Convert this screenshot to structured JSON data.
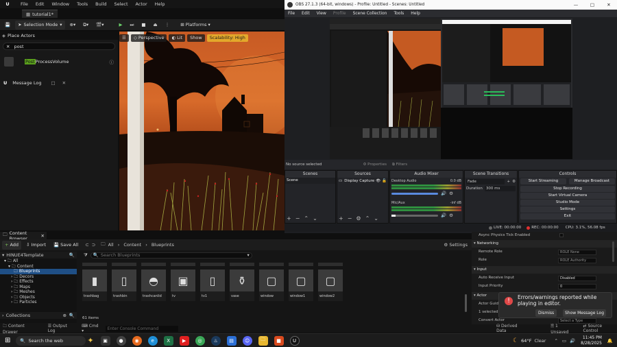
{
  "ue": {
    "menu": [
      "File",
      "Edit",
      "Window",
      "Tools",
      "Build",
      "Select",
      "Actor",
      "Help"
    ],
    "tab_title": "tutorial1*",
    "toolbar": {
      "selection_mode": "Selection Mode",
      "platforms": "Platforms"
    },
    "place_actors": {
      "tab": "Place Actors",
      "search_value": "post",
      "result_highlight": "Post",
      "result_rest": "ProcessVolume"
    },
    "message_log": "Message Log",
    "viewport": {
      "perspective": "Perspective",
      "lit": "Lit",
      "show": "Show",
      "scalability": "Scalability: High"
    },
    "content_browser": {
      "tab": "Content Browser",
      "add": "Add",
      "import": "Import",
      "save_all": "Save All",
      "breadcrumb": [
        "All",
        "Content",
        "Blueprints"
      ],
      "settings": "Settings",
      "project": "HINUE4Template",
      "search_placeholder": "Search Blueprints",
      "tree": [
        "All",
        "Content",
        "Blueprints",
        "Decors",
        "Effects",
        "Maps",
        "Meshes",
        "Objects",
        "Particles"
      ],
      "collections": "Collections",
      "items_count": "61 items",
      "assets": [
        {
          "name": "trashbag",
          "icon": "bag"
        },
        {
          "name": "trashbin",
          "icon": "bin"
        },
        {
          "name": "trashcanlid",
          "icon": "lid"
        },
        {
          "name": "tv",
          "icon": "tv"
        },
        {
          "name": "tv1",
          "icon": "bin"
        },
        {
          "name": "vase",
          "icon": "vase"
        },
        {
          "name": "window",
          "icon": "frame"
        },
        {
          "name": "window1",
          "icon": "frame"
        },
        {
          "name": "window2",
          "icon": "frame"
        }
      ]
    },
    "details": {
      "rows_top": [
        "Async Physics Tick Enabled"
      ],
      "section_networking": "Networking",
      "remote_role": {
        "label": "Remote Role",
        "value": "ROLE None"
      },
      "role": {
        "label": "Role",
        "value": "ROLE Authority"
      },
      "section_input": "Input",
      "auto_receive_input": {
        "label": "Auto Receive Input",
        "value": "Disabled"
      },
      "input_priority": {
        "label": "Input Priority",
        "value": "0"
      },
      "section_actor": "Actor",
      "actor_guid": "Actor Guid",
      "selected": "1 selected in",
      "convert_actor": "Convert Actor",
      "select_a_type": "Select a Type"
    },
    "toast": {
      "message": "Errors/warnings reported while playing in editor.",
      "dismiss": "Dismiss",
      "show_log": "Show Message Log"
    },
    "bottombar": {
      "content_drawer": "Content Drawer",
      "output_log": "Output Log",
      "cmd": "Cmd",
      "cmd_placeholder": "Enter Console Command",
      "derived_data": "Derived Data",
      "unsaved": "1 Unsaved",
      "source_control": "Source Control"
    }
  },
  "obs": {
    "title": "OBS 27.1.3 (64-bit, windows) - Profile: Untitled - Scenes: Untitled",
    "menu": [
      "File",
      "Edit",
      "View",
      "Profile",
      "Scene Collection",
      "Tools",
      "Help"
    ],
    "no_source": "No source selected",
    "properties": "Properties",
    "filters": "Filters",
    "scenes": {
      "header": "Scenes",
      "items": [
        "Scene"
      ]
    },
    "sources": {
      "header": "Sources",
      "items": [
        "Display Capture"
      ]
    },
    "audio": {
      "header": "Audio Mixer",
      "channels": [
        {
          "name": "Desktop Audio",
          "db": "0.0 dB"
        },
        {
          "name": "Mic/Aux",
          "db": "-inf dB"
        }
      ]
    },
    "transitions": {
      "header": "Scene Transitions",
      "type": "Fade",
      "duration_label": "Duration",
      "duration": "300 ms"
    },
    "controls": {
      "header": "Controls",
      "buttons": [
        "Start Streaming",
        "Manage Broadcast",
        "Stop Recording",
        "Start Virtual Camera",
        "Studio Mode",
        "Settings",
        "Exit"
      ]
    },
    "status": {
      "live": "LIVE: 00:00:00",
      "rec": "REC: 00:00:00",
      "cpu": "CPU: 3.1%, 56.08 fps"
    }
  },
  "taskbar": {
    "search": "Search the web",
    "weather": "64°F",
    "weather_desc": "Clear",
    "time": "11:45 PM",
    "date": "8/28/2025"
  }
}
